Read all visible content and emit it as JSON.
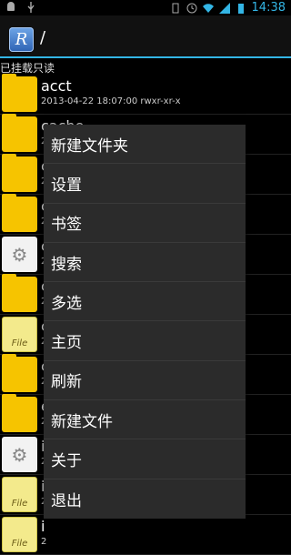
{
  "status": {
    "time": "14:38"
  },
  "titlebar": {
    "app_icon_letter": "R",
    "path": "/"
  },
  "mount_status": "已挂载只读",
  "rows": [
    {
      "name": "acct",
      "meta": "2013-04-22 18:07:00  rwxr-xr-x"
    },
    {
      "name": "cache",
      "meta": "2"
    },
    {
      "name": "c",
      "meta": "2"
    },
    {
      "name": "c",
      "meta": "2"
    },
    {
      "name": "c",
      "meta": "2"
    },
    {
      "name": "c",
      "meta": "2"
    },
    {
      "name": "c",
      "meta": "2"
    },
    {
      "name": "c",
      "meta": "2"
    },
    {
      "name": "e",
      "meta": "2"
    },
    {
      "name": "i",
      "meta": "2"
    },
    {
      "name": "i",
      "meta": "2"
    },
    {
      "name": "i",
      "meta": "2"
    }
  ],
  "note_label": "File",
  "menu": [
    {
      "label": "新建文件夹"
    },
    {
      "label": "设置"
    },
    {
      "label": "书签"
    },
    {
      "label": "搜索"
    },
    {
      "label": "多选"
    },
    {
      "label": "主页"
    },
    {
      "label": "刷新"
    },
    {
      "label": "新建文件"
    },
    {
      "label": "关于"
    },
    {
      "label": "退出"
    }
  ]
}
